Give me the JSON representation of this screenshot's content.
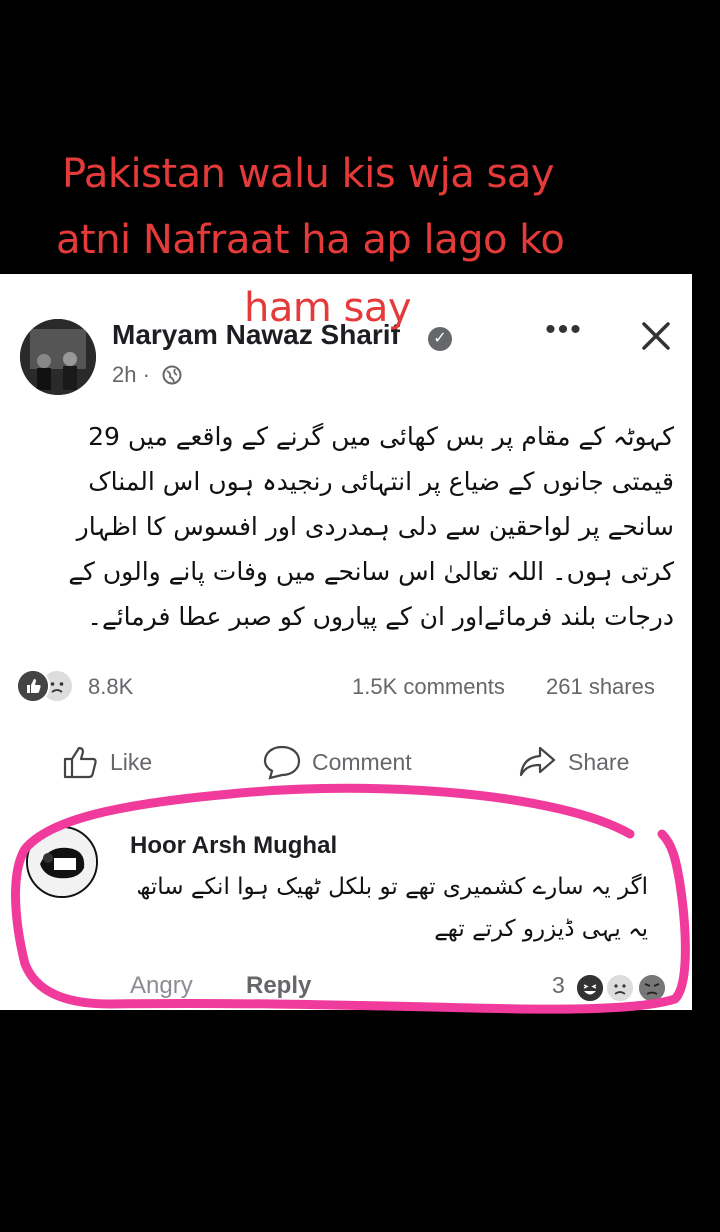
{
  "overlay": {
    "line1": "Pakistan walu kis wja say",
    "line2": "atni Nafraat ha ap lago ko",
    "line3": "ham say"
  },
  "post": {
    "author": "Maryam Nawaz Sharif",
    "time": "2h ·",
    "text": "کہوٹہ کے مقام پر بس کھائی میں گرنے کے واقعے میں 29 قیمتی جانوں کے ضیاع پر انتہائی رنجیدہ ہوں اس المناک سانحے پر لواحقین سے دلی ہمدردی اور افسوس کا اظہار کرتی ہوں۔ اللہ تعالیٰ اس سانحے میں وفات پانے والوں کے درجات بلند فرمائےاور ان کے پیاروں کو صبر عطا فرمائے۔",
    "reaction_count": "8.8K",
    "comments": "1.5K comments",
    "shares": "261 shares",
    "more_label": "•••"
  },
  "actions": {
    "like": "Like",
    "comment": "Comment",
    "share": "Share"
  },
  "comment": {
    "name": "Hoor Arsh Mughal",
    "text": "اگر یہ سارے کشمیری تھے تو بلکل ٹھیک ہوا انکے ساتھ یہ یہی ڈیزرو کرتے تھے",
    "angry": "Angry",
    "reply": "Reply",
    "reaction_count": "3"
  },
  "colors": {
    "caption": "#e53a3a",
    "highlight": "#f03b9c"
  },
  "icons": [
    "verified-icon",
    "globe-icon",
    "more-icon",
    "close-icon",
    "like-icon",
    "comment-icon",
    "share-icon",
    "reaction-like-icon",
    "reaction-sad-icon"
  ]
}
